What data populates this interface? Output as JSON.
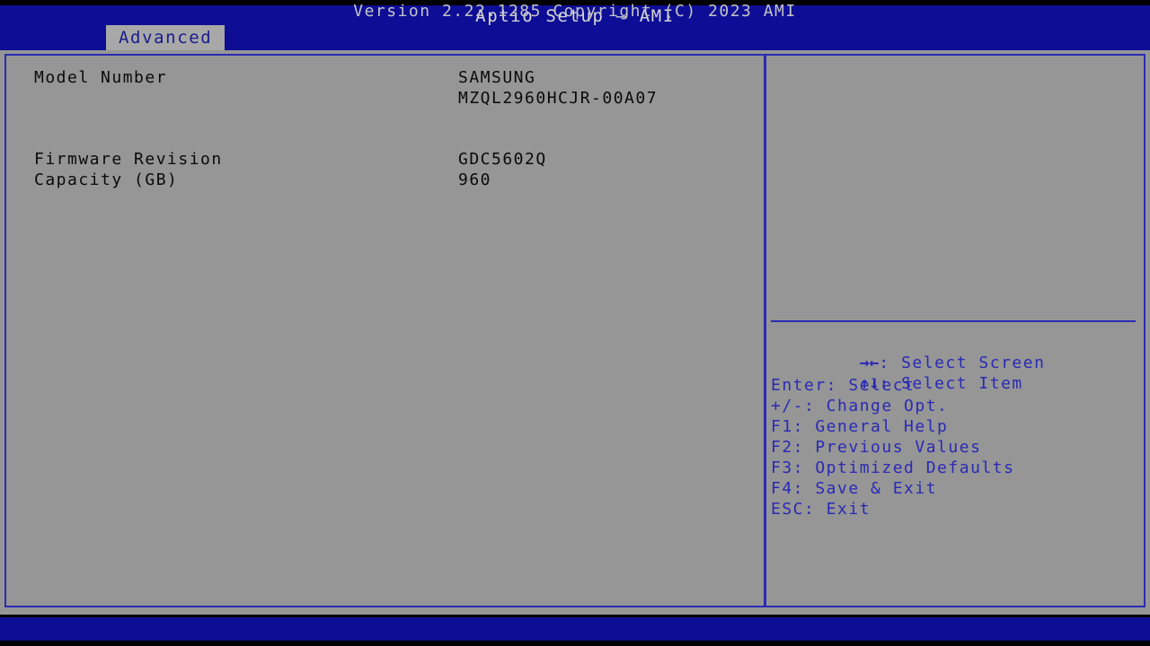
{
  "colors": {
    "header_blue": "#0d0d96",
    "panel_gray": "#969696",
    "border_blue": "#2a2ab4",
    "help_text_blue": "#2a2ab4",
    "label_black": "#0a0a0a",
    "title_white": "#d8d8d8",
    "tab_background": "#a8a8a8",
    "tab_text": "#1a1a8c",
    "outer_black": "#000000"
  },
  "header": {
    "title": "Aptio Setup – AMI",
    "tabs": [
      {
        "label": "Advanced",
        "active": true
      }
    ]
  },
  "main": {
    "rows": [
      {
        "label": "Model Number",
        "value": "SAMSUNG",
        "value_line2": "MZQL2960HCJR-00A07"
      },
      {
        "label": "Firmware Revision",
        "value": "GDC5602Q"
      },
      {
        "label": "Capacity (GB)",
        "value": "960"
      }
    ]
  },
  "help": {
    "items": [
      {
        "glyph": "→←",
        "text": ": Select Screen"
      },
      {
        "glyph": "↑↓",
        "text": ": Select Item"
      },
      {
        "glyph": "",
        "text": "Enter: Select"
      },
      {
        "glyph": "",
        "text": "+/-: Change Opt."
      },
      {
        "glyph": "",
        "text": "F1: General Help"
      },
      {
        "glyph": "",
        "text": "F2: Previous Values"
      },
      {
        "glyph": "",
        "text": "F3: Optimized Defaults"
      },
      {
        "glyph": "",
        "text": "F4: Save & Exit"
      },
      {
        "glyph": "",
        "text": "ESC: Exit"
      }
    ]
  },
  "footer": {
    "version_text": "Version 2.22.1285 Copyright (C) 2023 AMI"
  }
}
